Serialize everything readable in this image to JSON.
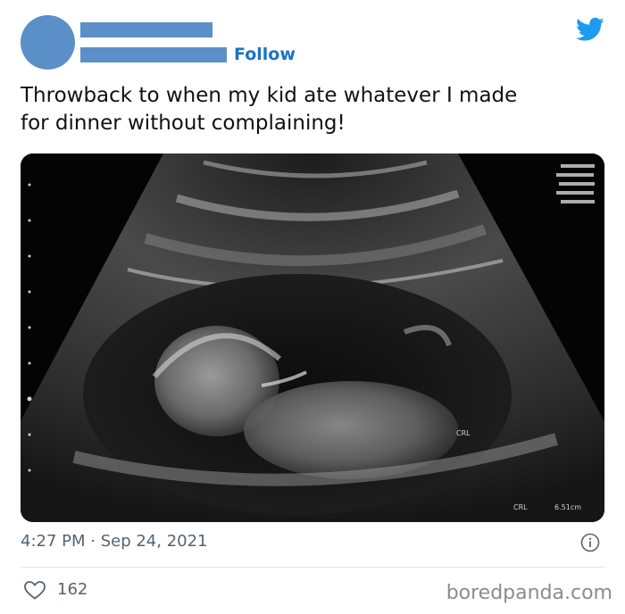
{
  "header": {
    "follow_label": "Follow",
    "brand_icon": "twitter-bird-icon",
    "accent_color": "#1d9bf0",
    "redaction_color": "#5b8fc7"
  },
  "tweet": {
    "text_lines": [
      "Throwback to when my kid ate whatever I made",
      "for dinner without complaining!"
    ],
    "timestamp": "4:27 PM · Sep 24, 2021",
    "likes": "162"
  },
  "media": {
    "scan_labels": {
      "measure_tag": "CRL",
      "footer_tag": "CRL",
      "footer_value": "6.51cm"
    }
  },
  "watermark": "boredpanda.com"
}
